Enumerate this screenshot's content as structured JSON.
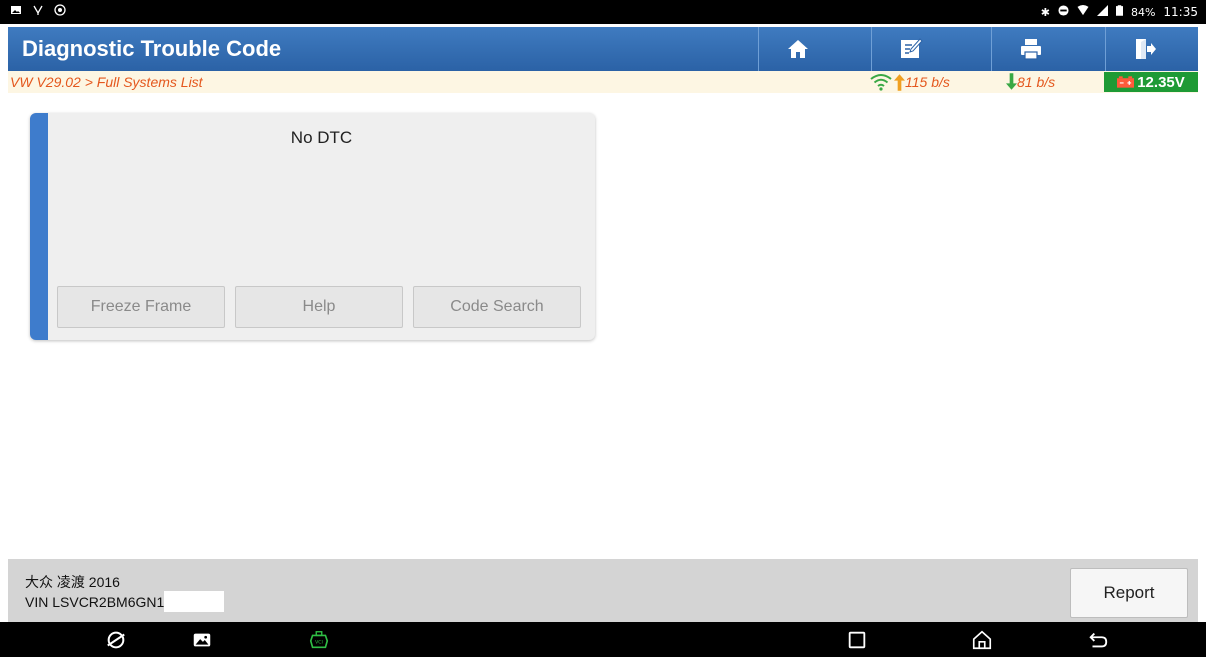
{
  "status_bar": {
    "battery_percent": "84%",
    "time": "11:35"
  },
  "header": {
    "title": "Diagnostic Trouble Code",
    "buttons": [
      "home-icon",
      "edit-icon",
      "print-icon",
      "exit-icon"
    ]
  },
  "breadcrumb": {
    "path": "VW V29.02 > Full Systems List",
    "upload_speed": "115 b/s",
    "download_speed": "81 b/s",
    "voltage": "12.35V"
  },
  "dtc_card": {
    "message": "No DTC",
    "buttons": {
      "freeze_frame": "Freeze Frame",
      "help": "Help",
      "code_search": "Code Search"
    }
  },
  "footer": {
    "vehicle": "大众 凌渡 2016",
    "vin": "VIN LSVCR2BM6GN1",
    "report_label": "Report"
  },
  "colors": {
    "title_bar": "#3171b8",
    "accent_stripe": "#3e7ccc",
    "breadcrumb_text": "#e4571d",
    "upload_arrow": "#f0a020",
    "download_arrow": "#39a845",
    "voltage_badge": "#1e9a35"
  }
}
